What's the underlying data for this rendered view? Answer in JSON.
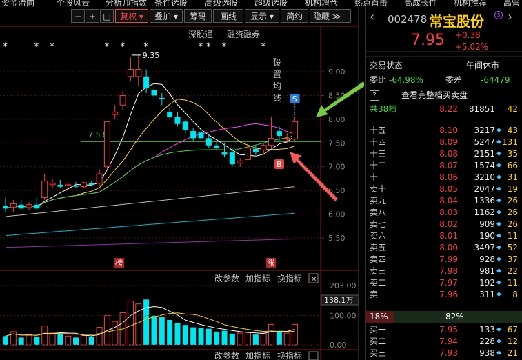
{
  "topnav": [
    "资金流向",
    "个股风云",
    "分析师指数",
    "条件选股",
    "高级选股",
    "超级选股",
    "机构增仓",
    "热点直击",
    "高成长性",
    "机构推荐",
    "高管"
  ],
  "toolbar": {
    "minus": "−",
    "plus": "+",
    "square": "□",
    "fuquan": "复权",
    "diejia": "叠加",
    "chouma": "筹码",
    "huaxian": "画线",
    "xianshi": "显示",
    "jianyue": "简约",
    "yincang": "隐藏",
    "more": "≫"
  },
  "sublinks": {
    "shenzhen": "深股通",
    "rongzi": "融资融券",
    "junxian": "设置均线"
  },
  "stock": {
    "code": "002478",
    "name": "常宝股份",
    "price": "7.95",
    "change": "+0.38",
    "pct": "+5.02%"
  },
  "status": {
    "label": "交易状态",
    "value": "午间休市"
  },
  "ratio": {
    "weibi_label": "委比",
    "weibi": "-64.98%",
    "weicha_label": "委差",
    "weicha": "-64479"
  },
  "full_book": "查看完整档买卖盘",
  "total": {
    "label": "共38档",
    "price": "8.22",
    "vol": "81851",
    "count": "42"
  },
  "asks": [
    {
      "label": "十五",
      "price": "8.10",
      "vol": "3217",
      "count": "43"
    },
    {
      "label": "十四",
      "price": "8.09",
      "vol": "5247",
      "count": "131"
    },
    {
      "label": "十三",
      "price": "8.08",
      "vol": "2151",
      "count": "35"
    },
    {
      "label": "十二",
      "price": "8.07",
      "vol": "1574",
      "count": "66"
    },
    {
      "label": "十一",
      "price": "8.06",
      "vol": "3210",
      "count": "31"
    },
    {
      "label": "卖十",
      "price": "8.05",
      "vol": "2047",
      "count": "19"
    },
    {
      "label": "卖九",
      "price": "8.04",
      "vol": "1336",
      "count": "26"
    },
    {
      "label": "卖八",
      "price": "8.03",
      "vol": "1162",
      "count": "26"
    },
    {
      "label": "卖七",
      "price": "8.02",
      "vol": "909",
      "count": "26"
    },
    {
      "label": "卖六",
      "price": "8.01",
      "vol": "190",
      "count": "11"
    },
    {
      "label": "卖五",
      "price": "8.00",
      "vol": "3497",
      "count": "52"
    },
    {
      "label": "卖四",
      "price": "7.99",
      "vol": "928",
      "count": "37"
    },
    {
      "label": "卖三",
      "price": "7.98",
      "vol": "981",
      "count": "22"
    },
    {
      "label": "卖二",
      "price": "7.97",
      "vol": "192",
      "count": "11"
    },
    {
      "label": "卖一",
      "price": "7.96",
      "vol": "311",
      "count": "8"
    }
  ],
  "split": {
    "buy": "18%",
    "sell": "82%",
    "buy_frac": 0.18
  },
  "bids": [
    {
      "label": "买一",
      "price": "7.95",
      "vol": "133",
      "count": "67"
    },
    {
      "label": "买二",
      "price": "7.94",
      "vol": "228",
      "count": "12"
    },
    {
      "label": "买三",
      "price": "7.93",
      "vol": "938",
      "count": "21"
    }
  ],
  "volpanel": {
    "gaican": "改参数",
    "jiazhi": "加指标",
    "huanzhi": "换指标",
    "close": "✕",
    "vmax": "203.00",
    "vmid": "100.00",
    "vzero": "0.00",
    "tag": "138.1万"
  },
  "chart_data": {
    "type": "candlestick",
    "price_ticks": [
      "9.00",
      "8.50",
      "8.00",
      "7.50",
      "7.00",
      "6.50",
      "6.00",
      "5.50"
    ],
    "ylim": [
      5.5,
      9.0
    ],
    "high_label": "9.35",
    "level_label": "7.53",
    "level": 7.53,
    "markers": {
      "bang": "榜",
      "zhang": "涨",
      "S": "S",
      "B": "B"
    },
    "candles": [
      {
        "o": 6.17,
        "h": 6.35,
        "l": 6.05,
        "c": 6.12,
        "v": 30
      },
      {
        "o": 6.15,
        "h": 6.3,
        "l": 6.05,
        "c": 6.22,
        "v": 45
      },
      {
        "o": 6.2,
        "h": 6.3,
        "l": 6.1,
        "c": 6.12,
        "v": 25
      },
      {
        "o": 6.14,
        "h": 6.25,
        "l": 6.08,
        "c": 6.2,
        "v": 35
      },
      {
        "o": 6.2,
        "h": 6.35,
        "l": 6.1,
        "c": 6.12,
        "v": 28
      },
      {
        "o": 6.35,
        "h": 6.85,
        "l": 6.3,
        "c": 6.7,
        "v": 65
      },
      {
        "o": 6.62,
        "h": 6.75,
        "l": 6.55,
        "c": 6.65,
        "v": 40
      },
      {
        "o": 6.62,
        "h": 6.72,
        "l": 6.55,
        "c": 6.58,
        "v": 38
      },
      {
        "o": 6.6,
        "h": 6.68,
        "l": 6.55,
        "c": 6.62,
        "v": 30
      },
      {
        "o": 6.6,
        "h": 6.68,
        "l": 6.55,
        "c": 6.58,
        "v": 25
      },
      {
        "o": 6.58,
        "h": 6.68,
        "l": 6.55,
        "c": 6.66,
        "v": 32
      },
      {
        "o": 6.65,
        "h": 6.7,
        "l": 6.6,
        "c": 6.62,
        "v": 28
      },
      {
        "o": 6.65,
        "h": 6.95,
        "l": 6.6,
        "c": 6.85,
        "v": 60
      },
      {
        "o": 7.0,
        "h": 7.95,
        "l": 6.95,
        "c": 7.95,
        "v": 100
      },
      {
        "o": 8.1,
        "h": 8.3,
        "l": 8.0,
        "c": 8.15,
        "v": 80
      },
      {
        "o": 8.3,
        "h": 8.6,
        "l": 8.2,
        "c": 8.5,
        "v": 110
      },
      {
        "o": 8.9,
        "h": 9.3,
        "l": 8.8,
        "c": 9.05,
        "v": 150
      },
      {
        "o": 8.9,
        "h": 9.35,
        "l": 8.7,
        "c": 9.05,
        "v": 140
      },
      {
        "o": 8.9,
        "h": 9.05,
        "l": 8.55,
        "c": 8.65,
        "v": 155
      },
      {
        "o": 8.62,
        "h": 8.7,
        "l": 8.4,
        "c": 8.5,
        "v": 100
      },
      {
        "o": 8.45,
        "h": 8.55,
        "l": 8.3,
        "c": 8.42,
        "v": 95
      },
      {
        "o": 8.15,
        "h": 8.25,
        "l": 8.0,
        "c": 8.05,
        "v": 85
      },
      {
        "o": 8.05,
        "h": 8.15,
        "l": 7.85,
        "c": 7.9,
        "v": 75
      },
      {
        "o": 7.95,
        "h": 8.0,
        "l": 7.7,
        "c": 7.78,
        "v": 68
      },
      {
        "o": 7.75,
        "h": 7.82,
        "l": 7.55,
        "c": 7.6,
        "v": 60
      },
      {
        "o": 7.72,
        "h": 7.78,
        "l": 7.55,
        "c": 7.6,
        "v": 58
      },
      {
        "o": 7.6,
        "h": 7.68,
        "l": 7.4,
        "c": 7.45,
        "v": 55
      },
      {
        "o": 7.45,
        "h": 7.55,
        "l": 7.35,
        "c": 7.4,
        "v": 45
      },
      {
        "o": 7.3,
        "h": 7.5,
        "l": 7.2,
        "c": 7.25,
        "v": 48
      },
      {
        "o": 7.3,
        "h": 7.4,
        "l": 7.0,
        "c": 7.05,
        "v": 38
      },
      {
        "o": 7.08,
        "h": 7.18,
        "l": 7.0,
        "c": 7.12,
        "v": 40
      },
      {
        "o": 7.15,
        "h": 7.45,
        "l": 7.1,
        "c": 7.4,
        "v": 42
      },
      {
        "o": 7.38,
        "h": 7.45,
        "l": 7.25,
        "c": 7.3,
        "v": 35
      },
      {
        "o": 7.35,
        "h": 7.5,
        "l": 7.25,
        "c": 7.45,
        "v": 40
      },
      {
        "o": 7.45,
        "h": 8.05,
        "l": 7.4,
        "c": 7.6,
        "v": 70
      },
      {
        "o": 7.75,
        "h": 7.85,
        "l": 7.55,
        "c": 7.65,
        "v": 45
      },
      {
        "o": 7.58,
        "h": 7.7,
        "l": 7.5,
        "c": 7.6,
        "v": 40
      },
      {
        "o": 7.58,
        "h": 8.05,
        "l": 7.55,
        "c": 7.95,
        "v": 70
      }
    ]
  }
}
